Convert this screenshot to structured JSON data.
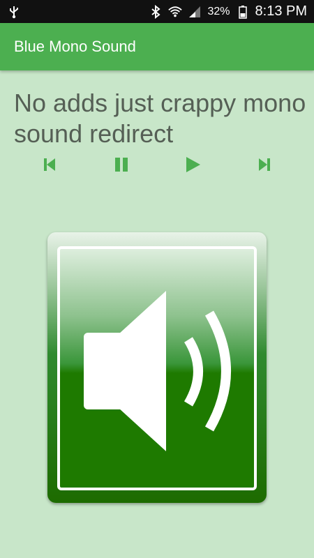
{
  "status_bar": {
    "icons": [
      "usb-icon",
      "bluetooth-icon",
      "wifi-icon",
      "signal-icon",
      "battery-icon"
    ],
    "battery_percent": "32%",
    "time": "8:13 PM"
  },
  "app_bar": {
    "title": "Blue Mono Sound",
    "color": "#4caf50"
  },
  "main": {
    "message": "No adds just crappy mono sound redirect",
    "controls": [
      {
        "name": "previous",
        "icon": "skip-previous-icon"
      },
      {
        "name": "pause",
        "icon": "pause-icon"
      },
      {
        "name": "play",
        "icon": "play-icon"
      },
      {
        "name": "next",
        "icon": "skip-next-icon"
      }
    ],
    "control_color": "#4caf50",
    "speaker_button": {
      "icon": "speaker-volume-icon"
    }
  },
  "colors": {
    "background": "#c8e6c9",
    "text": "#555f55",
    "speaker_green": "#1e7a00"
  }
}
